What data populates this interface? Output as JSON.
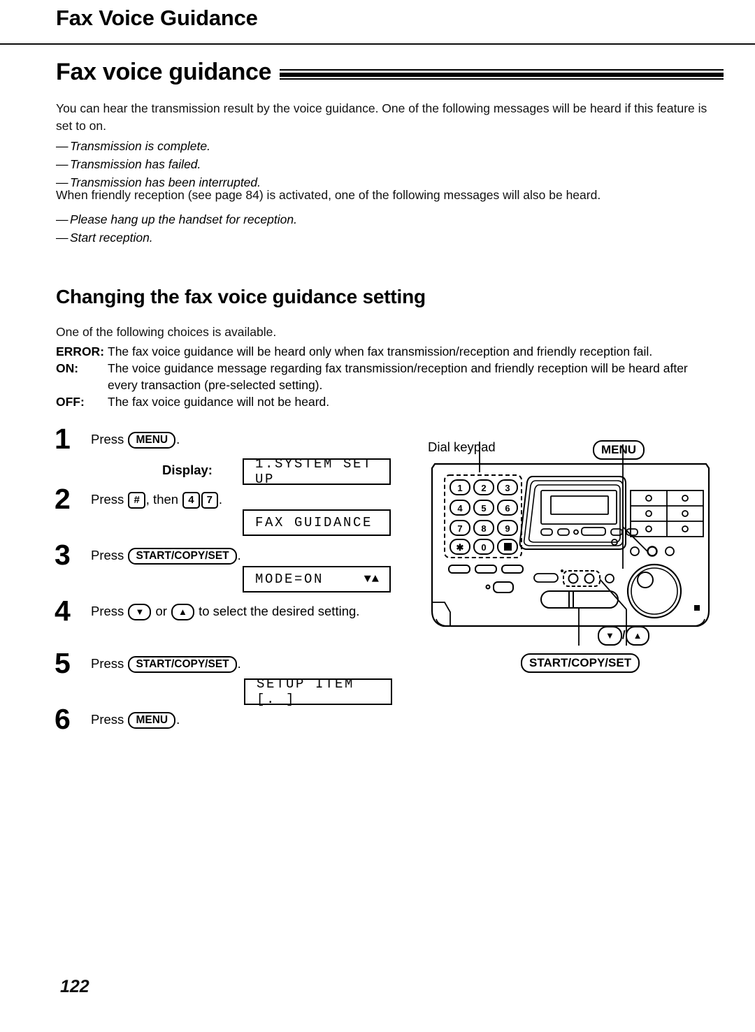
{
  "running_header": "Fax Voice Guidance",
  "section": {
    "title": "Fax voice guidance",
    "intro": "You can hear the transmission result by the voice guidance. One of the following messages will be heard if this feature is set to on.",
    "messages_1": [
      "Transmission is complete.",
      "Transmission has failed.",
      "Transmission has been interrupted."
    ],
    "friendly_para": "When friendly reception (see page 84) is activated, one of the following messages will also be heard.",
    "messages_2": [
      "Please hang up the handset for reception.",
      "Start reception."
    ],
    "dash": "—"
  },
  "subsection": {
    "title": "Changing the fax voice guidance setting",
    "intro": "One of the following choices is available.",
    "choices": [
      {
        "term": "ERROR:",
        "definition": "The fax voice guidance will be heard only when fax transmission/reception and friendly reception fail."
      },
      {
        "term": "ON:",
        "definition": "The voice guidance message regarding fax transmission/reception and friendly reception will be heard after every transaction (pre-selected setting)."
      },
      {
        "term": "OFF:",
        "definition": "The fax voice guidance will not be heard."
      }
    ]
  },
  "steps": [
    {
      "num": "1",
      "press": "Press",
      "key": "MENU",
      "tail": "."
    },
    {
      "num": "2",
      "press": "Press",
      "key": "#",
      "mid": ", then",
      "key2": "4",
      "key3": "7",
      "tail": "."
    },
    {
      "num": "3",
      "press": "Press",
      "key": "START/COPY/SET",
      "tail": "."
    },
    {
      "num": "4",
      "press": "Press",
      "key": "▼",
      "mid": "or",
      "key2": "▲",
      "tail": "to select the desired setting."
    },
    {
      "num": "5",
      "press": "Press",
      "key": "START/COPY/SET",
      "tail": "."
    },
    {
      "num": "6",
      "press": "Press",
      "key": "MENU",
      "tail": "."
    }
  ],
  "display_label": "Display:",
  "lcd_screens": [
    {
      "text": "1.SYSTEM SET UP",
      "arrows": ""
    },
    {
      "text": "FAX GUIDANCE",
      "arrows": ""
    },
    {
      "text": "MODE=ON",
      "arrows": "▼▲"
    },
    {
      "text": "SETUP ITEM [.  ]",
      "arrows": ""
    }
  ],
  "diagram": {
    "dial_keypad_label": "Dial keypad",
    "menu_callout": "MENU",
    "updown_callout_down": "▼",
    "updown_callout_sep": "/",
    "updown_callout_up": "▲",
    "startcopy_callout": "START/COPY/SET",
    "keypad_keys": [
      "1",
      "2",
      "3",
      "4",
      "5",
      "6",
      "7",
      "8",
      "9",
      "✱",
      "0",
      "▣"
    ]
  },
  "page_number": "122"
}
